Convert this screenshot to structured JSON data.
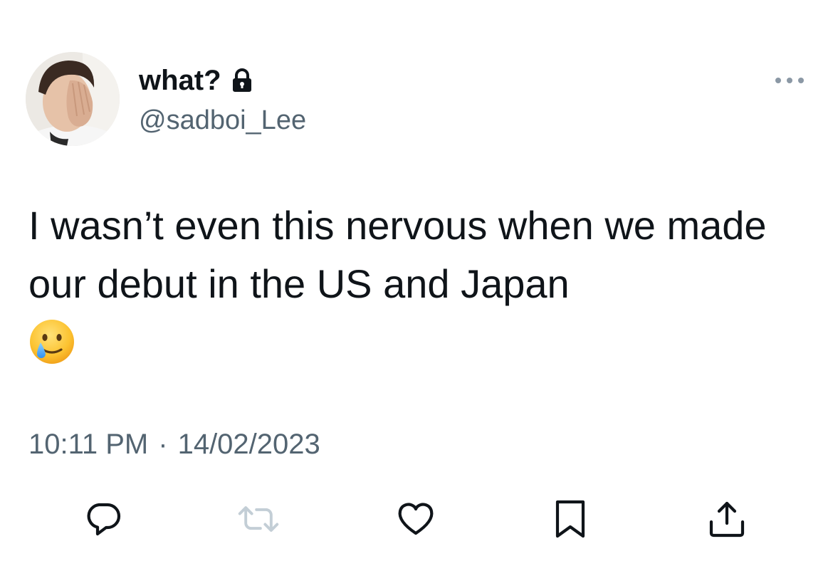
{
  "tweet": {
    "display_name": "what?",
    "handle": "@sadboi_Lee",
    "text": "I wasn’t even this nervous when we made our debut in the US and Japan",
    "time": "10:11 PM",
    "separator": "·",
    "date": "14/02/2023"
  },
  "icons": {
    "lock": "lock-icon",
    "more": "more-icon",
    "emoji": "crying-smiling-face-emoji",
    "reply": "reply-icon",
    "retweet": "retweet-icon",
    "like": "heart-icon",
    "bookmark": "bookmark-icon",
    "share": "share-icon"
  },
  "colors": {
    "text": "#0f1419",
    "secondary": "#536471",
    "retweet_disabled": "#c3ced6"
  }
}
